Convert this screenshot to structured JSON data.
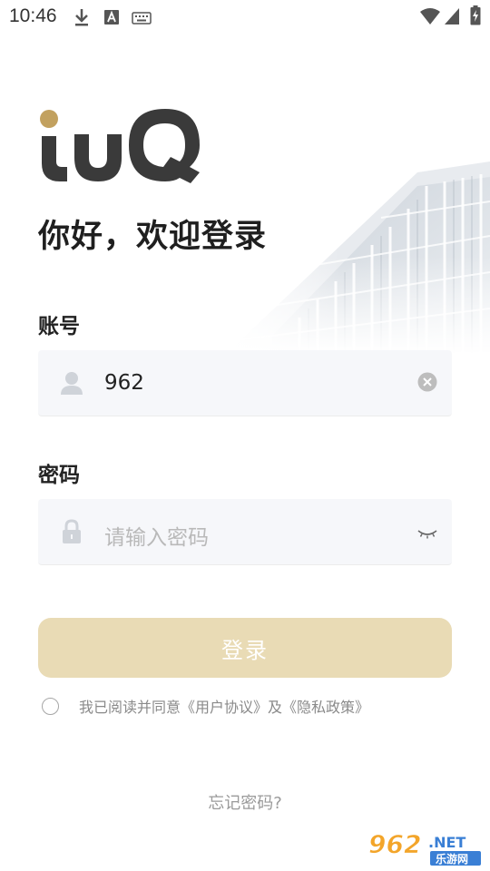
{
  "status_bar": {
    "time": "10:46",
    "icons": [
      "download-icon",
      "text-a-icon",
      "keyboard-icon",
      "wifi-icon",
      "signal-icon",
      "battery-charging-icon"
    ]
  },
  "brand": {
    "logo_text": "iUQ"
  },
  "greeting": "你好，欢迎登录",
  "account": {
    "label": "账号",
    "value": "962",
    "lead_icon": "user-icon",
    "trail_icon": "clear-icon"
  },
  "password": {
    "label": "密码",
    "placeholder": "请输入密码",
    "value": "",
    "lead_icon": "lock-icon",
    "trail_icon": "eye-closed-icon"
  },
  "login_button": "登录",
  "agreement": {
    "checked": false,
    "prefix": "我已阅读并同意",
    "user_agreement": "《用户协议》",
    "and": "及",
    "privacy_policy": "《隐私政策》"
  },
  "forgot_password": "忘记密码?",
  "watermark": {
    "number": "962",
    "domain": ".NET",
    "site": "乐游网"
  },
  "colors": {
    "accent": "#e9dbb5",
    "logo_gold": "#c2a15f",
    "logo_dark": "#3a3a3a",
    "text_dark": "#1f1f1f",
    "muted": "#8a8a8a"
  }
}
